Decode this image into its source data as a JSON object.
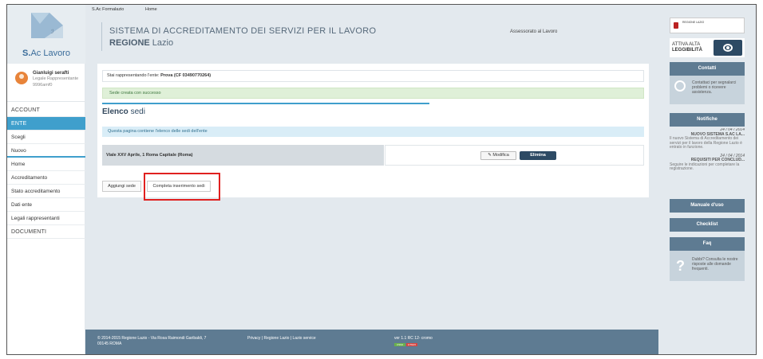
{
  "top_nav": {
    "item1": "S.Ac Formalazio",
    "item2": "Home"
  },
  "brand": {
    "prefix": "S.",
    "name": "Ac Lavoro"
  },
  "user": {
    "name": "Gianluigi serafti",
    "role": "Legale Rappresentante",
    "code": "9996amf0"
  },
  "sidebar": {
    "items": [
      {
        "label": "ACCOUNT"
      },
      {
        "label": "ENTE"
      },
      {
        "label": "Scegli"
      },
      {
        "label": "Nuovo"
      },
      {
        "label": "Home"
      },
      {
        "label": "Accreditamento"
      },
      {
        "label": "Stato accreditamento"
      },
      {
        "label": "Dati ente"
      },
      {
        "label": "Legali rappresentanti"
      },
      {
        "label": "DOCUMENTI"
      }
    ]
  },
  "header": {
    "title_line1": "SISTEMA DI ACCREDITAMENTO DEI SERVIZI PER IL LAVORO",
    "title_line2_bold": "REGIONE",
    "title_line2": " Lazio",
    "assessor": "Assessorato al Lavoro"
  },
  "main": {
    "entity_prefix": "Stai rappresentando l'ente: ",
    "entity_name": "Prova",
    "entity_cf": " (CF 03490770264)",
    "success_message": "Sede creata con successo",
    "section_title_bold": "Elenco",
    "section_title": " sedi",
    "info_text": "Questa pagina contiene l'elenco delle sedi dell'ente",
    "sede_address": "Viale XXV Aprile, 1 Roma Capitale (Roma)",
    "edit_label": "Modifica",
    "delete_label": "Elimina",
    "add_label": "Aggiungi sede",
    "complete_label": "Completa inserimento sedi"
  },
  "footer": {
    "address_line1": "© 2014-2015 Regione Lazio - Via Rosa Raimondi Garibaldi, 7",
    "address_line2": "00145 ROMA",
    "links": "Privacy | Regione Lazio | Lazio service",
    "version": "ver 1.1 RC 12- cromo",
    "badge1": "CSS3",
    "badge2": "HTML5"
  },
  "right": {
    "region_logo": "REGIONE LAZIO",
    "access_line1": "ATTIVA ALTA",
    "access_line2": "LEGGIBILITÀ",
    "contacts_title": "Contatti",
    "contacts_text": "Contattaci per segnalarci problemi o ricevere assistenza.",
    "notifications_title": "Notifiche",
    "news": [
      {
        "date": "24 / 04 / 2014",
        "title": "NUOVO SISTEMA S.AC LA...",
        "text": "Il nuovo Sistema di Accreditamento dei servizi per il lavoro della Regione Lazio è entrato in funzione."
      },
      {
        "date": "24 / 04 / 2014",
        "title": "REQUISITI PER CONCLUD...",
        "text": "Seguire le indicazioni per completare la registrazione."
      }
    ],
    "manual_label": "Manuale d'uso",
    "checklist_label": "Checklist",
    "faq_title": "Faq",
    "faq_text": "Dubbi? Consulta le nostre risposte alle domande frequenti."
  },
  "colors": {
    "accent": "#3f9fcc",
    "panel_bg": "#e3e9ee",
    "dark_button": "#2d4a64",
    "footer_bg": "#5e7b92",
    "highlight": "#e0201f"
  }
}
